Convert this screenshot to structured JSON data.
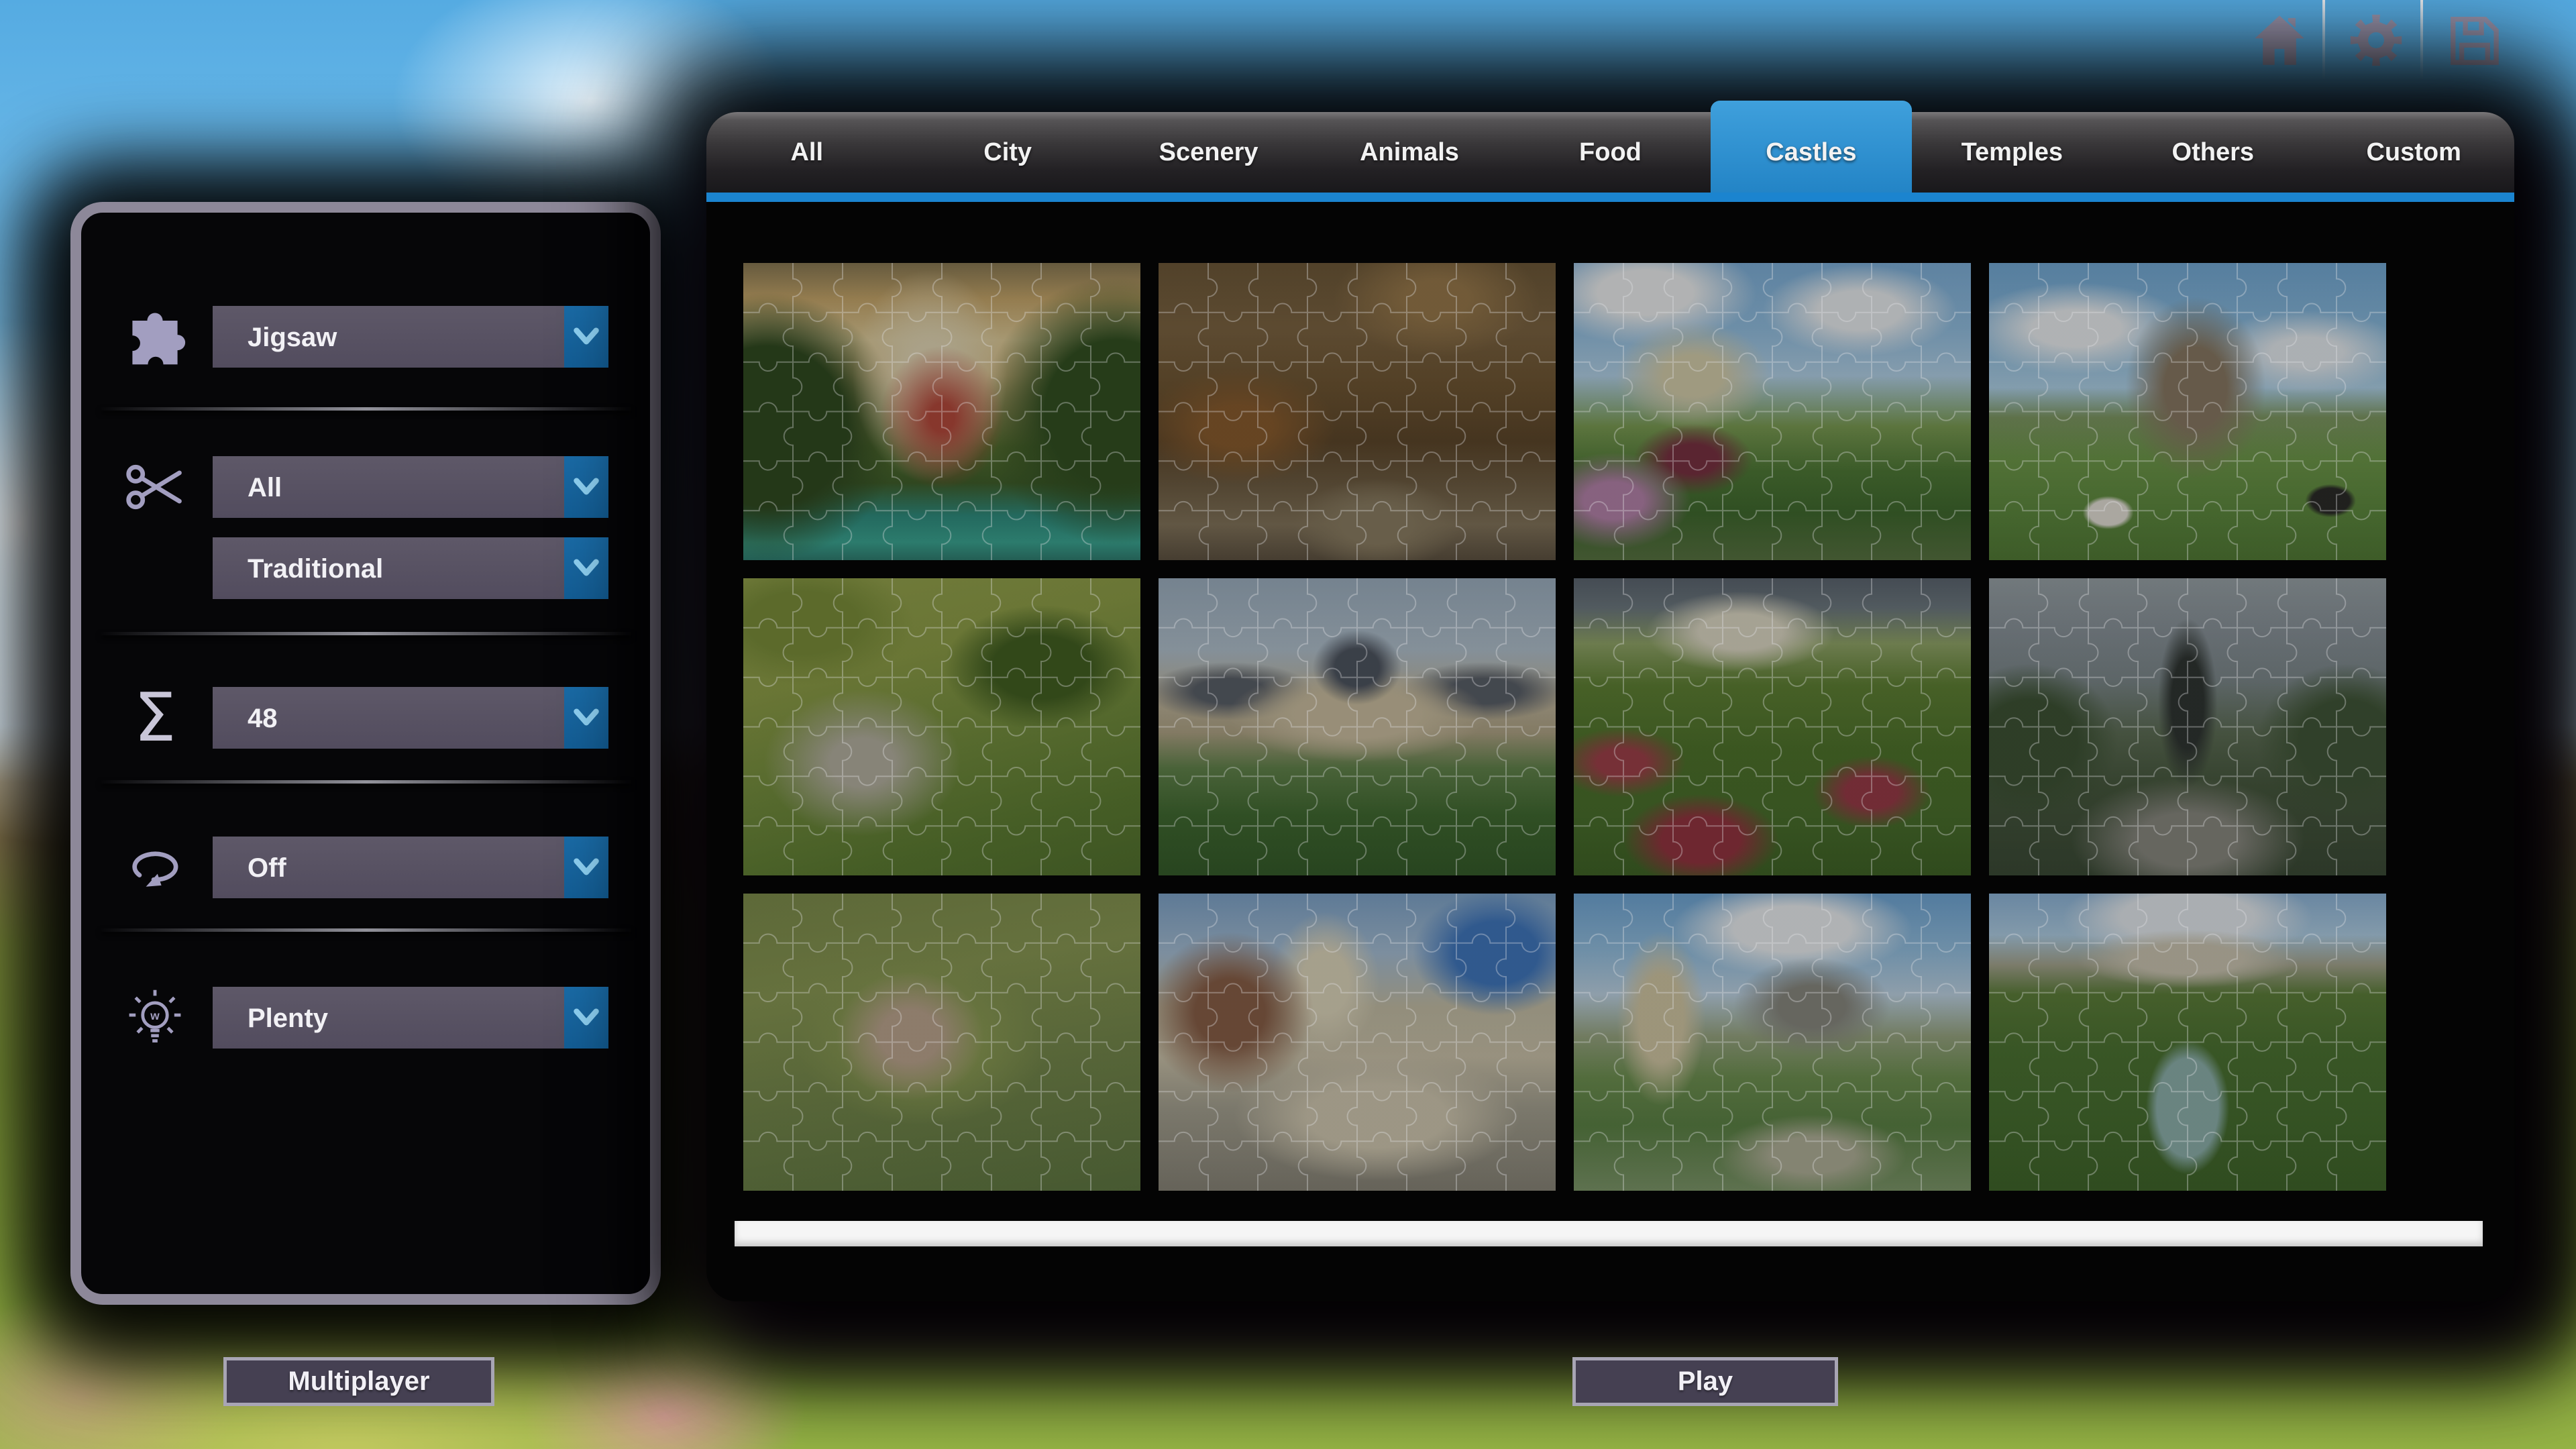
{
  "topbar": {
    "icons": [
      {
        "name": "home"
      },
      {
        "name": "settings"
      },
      {
        "name": "save"
      }
    ]
  },
  "tabs": {
    "items": [
      "All",
      "City",
      "Scenery",
      "Animals",
      "Food",
      "Castles",
      "Temples",
      "Others",
      "Custom"
    ],
    "active_index": 5,
    "active_label": "Castles"
  },
  "settings_panel": {
    "groups": [
      {
        "rows": [
          {
            "icon": "puzzle-piece",
            "value": "Jigsaw"
          }
        ]
      },
      {
        "rows": [
          {
            "icon": "scissors",
            "value": "All"
          },
          {
            "icon": null,
            "value": "Traditional"
          }
        ]
      },
      {
        "rows": [
          {
            "icon": "sigma",
            "value": "48"
          }
        ]
      },
      {
        "rows": [
          {
            "icon": "rotation",
            "value": "Off"
          }
        ]
      },
      {
        "rows": [
          {
            "icon": "hint-bulb",
            "value": "Plenty"
          }
        ]
      }
    ]
  },
  "actions": {
    "multiplayer": "Multiplayer",
    "play": "Play"
  },
  "gallery": {
    "pieces_grid": {
      "cols": 8,
      "rows": 6
    },
    "images": [
      {
        "name": "castle-lake-sunset",
        "bg": "radial-gradient(ellipse 26% 40% at 50% 52%, #b8493a 12%, rgba(184,73,58,0) 60%), radial-gradient(ellipse 30% 55% at 47% 38%, #e8dcb8 20%, rgba(232,220,184,0) 65%), radial-gradient(ellipse 45% 60% at 6% 55%, #2f4a1e 45%, rgba(47,74,30,0) 75%), radial-gradient(ellipse 45% 60% at 94% 50%, #31501f 40%, rgba(49,80,31,0) 75%), linear-gradient(180deg, #8a7a52 0%, #caa96a 12%, #e3cf9a 26%, #d9bd84 38%, #9a9458 50%, #55702e 62%, #3f5f28 74%, #2e8f7f 85%, #3aa893 94%, #2e7f70 100%)"
      },
      {
        "name": "autumn-river-village",
        "bg": "radial-gradient(ellipse 40% 30% at 70% 12%, #9a7a4a 20%, rgba(154,122,74,0) 65%), radial-gradient(ellipse 35% 28% at 20% 55%, #8a5c2c 25%, rgba(138,92,44,0) 70%), radial-gradient(ellipse 30% 22% at 55% 88%, #8d7f62 30%, rgba(141,127,98,0) 70%), linear-gradient(180deg, #6e5836 0%, #7d6440 22%, #6f5530 42%, #5d4628 60%, #6e5c40 74%, #84755a 88%, #5e5240 100%)"
      },
      {
        "name": "montsoreau-chateau-garden",
        "bg": "radial-gradient(ellipse 30% 28% at 30% 38%, #d9d2ae 25%, rgba(217,210,174,0) 65%), radial-gradient(ellipse 40% 25% at 18% 10%, #f2f4f4 30%, rgba(242,244,244,0) 70%), radial-gradient(ellipse 35% 22% at 72% 16%, #eef2f4 30%, rgba(238,242,244,0) 70%), radial-gradient(ellipse 30% 25% at 10% 80%, #b884ac 25%, rgba(184,132,172,0) 65%), radial-gradient(ellipse 25% 20% at 30% 66%, #7a3040 25%, rgba(122,48,64,0) 60%), linear-gradient(180deg, #7fb2dc 0%, #94c2e4 22%, #b6d6ec 38%, #7c9e52 55%, #4e7a34 70%, #3f6a2c 84%, #587440 100%)"
      },
      {
        "name": "mont-saint-michel-sheep",
        "bg": "radial-gradient(ellipse 26% 45% at 52% 42%, #8a7a62 30%, rgba(138,122,98,0) 68%), radial-gradient(ellipse 40% 22% at 22% 22%, #f0f4f6 28%, rgba(240,244,246,0) 70%), radial-gradient(ellipse 36% 20% at 80% 30%, #eaf0f4 25%, rgba(234,240,244,0) 70%), radial-gradient(ellipse 8% 7% at 30% 84%, #e8e4da 60%, rgba(232,228,218,0) 80%), radial-gradient(ellipse 8% 7% at 86% 80%, #2a2a26 60%, rgba(42,42,38,0) 80%), linear-gradient(180deg, #74acd8 0%, #8fc0e2 26%, #b2d6ec 42%, #7f9a62 52%, #6e9a48 66%, #5d8a3c 84%, #527c34 100%)"
      },
      {
        "name": "castle-ruins-aerial",
        "bg": "radial-gradient(ellipse 45% 45% at 30% 62%, #b8b4a2 18%, rgba(184,180,162,0) 55%), radial-gradient(ellipse 35% 30% at 75% 30%, #42601f 35%, rgba(66,96,31,0) 70%), radial-gradient(ellipse 40% 30% at 15% 15%, #7c9038 35%, rgba(124,144,56,0) 70%), linear-gradient(165deg, #9aa84e 0%, #8fa046 30%, #75903c 55%, #5d7e30 80%, #52722c 100%)"
      },
      {
        "name": "vaux-le-vicomte-palace",
        "bg": "radial-gradient(ellipse 16% 18% at 50% 30%, #4e5560 35%, rgba(78,85,96,0) 70%), radial-gradient(ellipse 45% 22% at 50% 46%, #cfc2a2 35%, rgba(207,194,162,0) 72%), radial-gradient(ellipse 30% 14% at 18% 38%, #5a6068 30%, rgba(90,96,104,0) 70%), radial-gradient(ellipse 30% 14% at 82% 38%, #5a6068 30%, rgba(90,96,104,0) 70%), linear-gradient(180deg, #9fb2c2 0%, #b4c4d0 24%, #c4baa0 40%, #b2a686 52%, #62854a 64%, #3f6a2e 80%, #345c28 100%)"
      },
      {
        "name": "villandry-gardens",
        "bg": "radial-gradient(ellipse 35% 20% at 42% 18%, #e2ddc8 30%, rgba(226,221,200,0) 68%), radial-gradient(ellipse 28% 22% at 32% 88%, #96333e 35%, rgba(150,51,62,0) 70%), radial-gradient(ellipse 22% 18% at 75% 72%, #9a3a46 30%, rgba(154,58,70,0) 68%), radial-gradient(ellipse 25% 18% at 12% 62%, #a04048 25%, rgba(160,64,72,0) 65%), linear-gradient(180deg, #5c6670 0%, #6e7a80 10%, #93a868 22%, #5f8232 36%, #4e7429 58%, #49702a 80%, #3f6424 100%)"
      },
      {
        "name": "garden-fountain-statue",
        "bg": "radial-gradient(ellipse 10% 38% at 50% 42%, #2e3430 40%, rgba(46,52,48,0) 75%), radial-gradient(ellipse 42% 30% at 50% 88%, #8a8a80 30%, rgba(138,138,128,0) 70%), radial-gradient(ellipse 30% 35% at 10% 55%, #3c5232 40%, rgba(60,82,50,0) 75%), radial-gradient(ellipse 30% 35% at 90% 55%, #405636 40%, rgba(64,86,54,0) 75%), linear-gradient(180deg, #9aa4a8 0%, #8a949a 18%, #7e8a8c 34%, #5d6e54 52%, #46583c 70%, #3a4a34 100%)"
      },
      {
        "name": "star-fortress-aerial",
        "bg": "radial-gradient(ellipse 30% 35% at 42% 48%, #c0a890 25%, rgba(192,168,144,0) 62%), radial-gradient(ellipse 45% 40% at 45% 50%, #8fa054 30%, rgba(143,160,84,0) 70%), linear-gradient(170deg, #7e8e4a 0%, #8a9a52 30%, #75894a 60%, #5f7840 100%)"
      },
      {
        "name": "chambord-rooftops",
        "bg": "radial-gradient(ellipse 35% 45% at 18% 40%, #8a5f46 25%, rgba(138,95,70,0) 60%), radial-gradient(ellipse 50% 30% at 55% 75%, #d6cdb4 35%, rgba(214,205,180,0) 72%), radial-gradient(ellipse 20% 35% at 42% 30%, #e2dabe 30%, rgba(226,218,190,0) 68%), radial-gradient(ellipse 30% 30% at 85% 20%, #3f78c0 35%, rgba(63,120,192,0) 70%), linear-gradient(180deg, #7fa6cc 0%, #a9c2d8 20%, #c8c2a8 38%, #cfc6ac 55%, #a8a492 72%, #8a8678 100%)"
      },
      {
        "name": "chenonceau-tower",
        "bg": "radial-gradient(ellipse 16% 42% at 22% 42%, #d6cba6 35%, rgba(214,203,166,0) 70%), radial-gradient(ellipse 30% 25% at 60% 38%, #8a8a80 28%, rgba(138,138,128,0) 66%), radial-gradient(ellipse 42% 22% at 55% 12%, #f0f4f6 35%, rgba(240,244,246,0) 72%), radial-gradient(ellipse 35% 20% at 60% 88%, #b4b49a 30%, rgba(180,180,154,0) 68%), linear-gradient(180deg, #6fa8d8 0%, #98c4e4 20%, #c2d8e8 34%, #9aa882 48%, #6f9350 62%, #5c8444 78%, #7f9a6a 100%)"
      },
      {
        "name": "cheverny-garden-canal",
        "bg": "radial-gradient(ellipse 14% 30% at 50% 72%, #8fb4ae 55%, rgba(143,180,174,0) 75%), radial-gradient(ellipse 40% 14% at 50% 22%, #cfc9b4 35%, rgba(207,201,180,0) 70%), radial-gradient(ellipse 42% 20% at 50% 8%, #e8eef2 40%, rgba(232,238,242,0) 75%), linear-gradient(180deg, #8fb8dc 0%, #b2d2e8 14%, #a8a890 24%, #5d8038 34%, #4c7430 52%, #47702e 72%, #3f6628 100%)"
      }
    ]
  },
  "colors": {
    "accent_blue": "#2e93d6",
    "tab_underline": "#1b84cf",
    "dropdown_body": "#575061",
    "dropdown_button": "#17649f",
    "chevron": "#8fd2f4",
    "panel_border": "#8d8899",
    "button_bg": "#454052",
    "button_border": "#a8a5b4",
    "scrollbar": "#f5f5f5",
    "icon_lavender": "#a29ec0",
    "purple_glow": "#8a23b4"
  }
}
